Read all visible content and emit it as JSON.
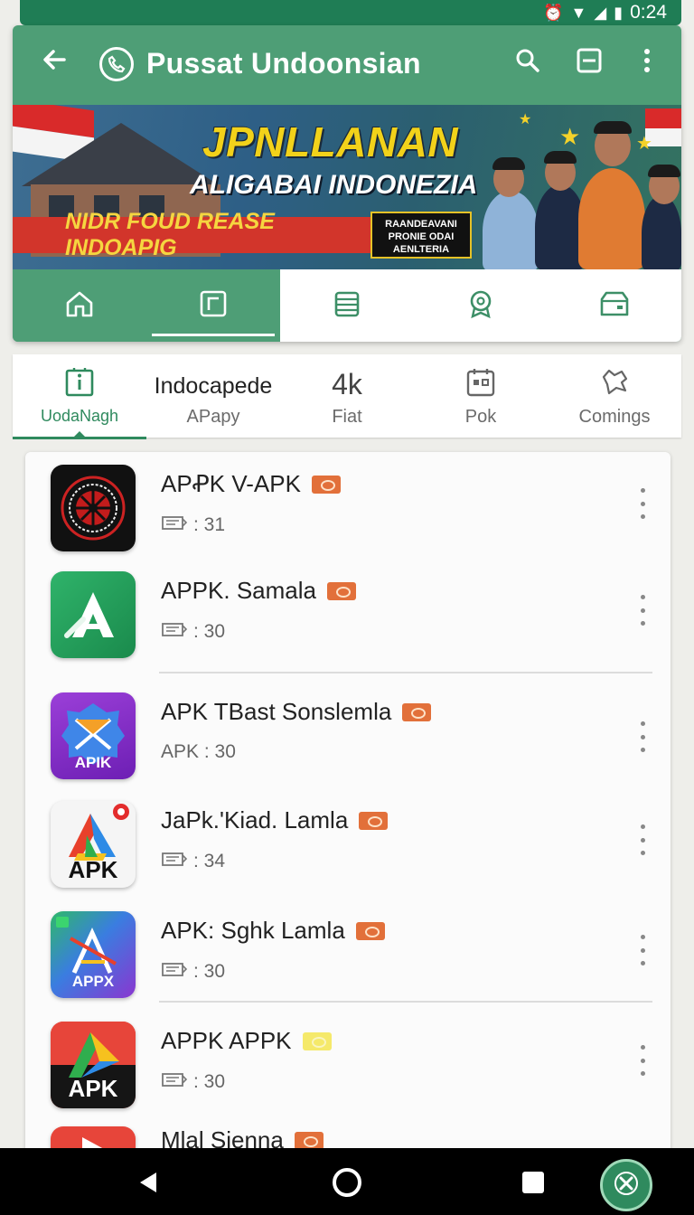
{
  "status_bar": {
    "time": "0:24",
    "icons": [
      "alarm-icon",
      "wifi-icon",
      "signal-icon",
      "battery-icon"
    ]
  },
  "toolbar": {
    "title": "Pussat Undoonsian",
    "back_icon": "arrow-left-icon",
    "logo_icon": "phone-circle-icon",
    "actions": [
      "search-icon",
      "window-icon",
      "more-vert-icon"
    ]
  },
  "banner": {
    "headline": "JPNLLANAN",
    "subheadline": "ALIGABAI INDONEZIA",
    "strip_text": "NIDR FOUD REASE INDOAPIG",
    "box_text": [
      "RAANDEAVANI",
      "PRONIE ODAI",
      "AENLTERIA"
    ]
  },
  "nav_tabs": [
    {
      "icon": "home-icon"
    },
    {
      "icon": "frame-icon",
      "active": true
    },
    {
      "icon": "database-icon"
    },
    {
      "icon": "badge-icon"
    },
    {
      "icon": "store-icon"
    }
  ],
  "category_tabs": [
    {
      "label": "UodaNagh",
      "top_icon": "info-icon",
      "active": true
    },
    {
      "label": "APapy",
      "top_text": "Indocapede"
    },
    {
      "label": "Fiat",
      "top_text": "4k"
    },
    {
      "label": "Pok",
      "top_icon": "calendar-icon"
    },
    {
      "label": "Comings",
      "top_icon": "map-icon"
    }
  ],
  "apps": [
    {
      "name": "APꝒK V-APK",
      "meta": ": 31",
      "meta_prefix_icon": "card-icon",
      "badge": "orange"
    },
    {
      "name": "APPK. Samala",
      "meta": ": 30",
      "meta_prefix_icon": "card-icon",
      "badge": "orange"
    },
    {
      "name": "APK TBast Sonslemla",
      "meta": "APK : 30",
      "badge": "orange"
    },
    {
      "name": "JaPk.'Kiad. Lamla",
      "meta": ": 34",
      "meta_prefix_icon": "card-icon",
      "badge": "orange"
    },
    {
      "name": "APK: Sghk Lamla",
      "meta": ": 30",
      "meta_prefix_icon": "card-icon",
      "badge": "orange"
    },
    {
      "name": "APPK APPK",
      "meta": ": 30",
      "meta_prefix_icon": "card-icon",
      "badge": "yellow"
    },
    {
      "name": "Mlal Sienna",
      "badge": "orange"
    }
  ],
  "app_icon_text": {
    "icon3": "APIK",
    "icon4": "APK",
    "icon5": "APPX",
    "icon6": "APK"
  },
  "system_nav": [
    "back-icon",
    "home-circle-icon",
    "recents-icon"
  ],
  "fab_icon": "close-icon",
  "colors": {
    "primary": "#4e9e76",
    "dark": "#1f7d55",
    "accent": "#2f8a5e",
    "badge": "#e2703a"
  }
}
